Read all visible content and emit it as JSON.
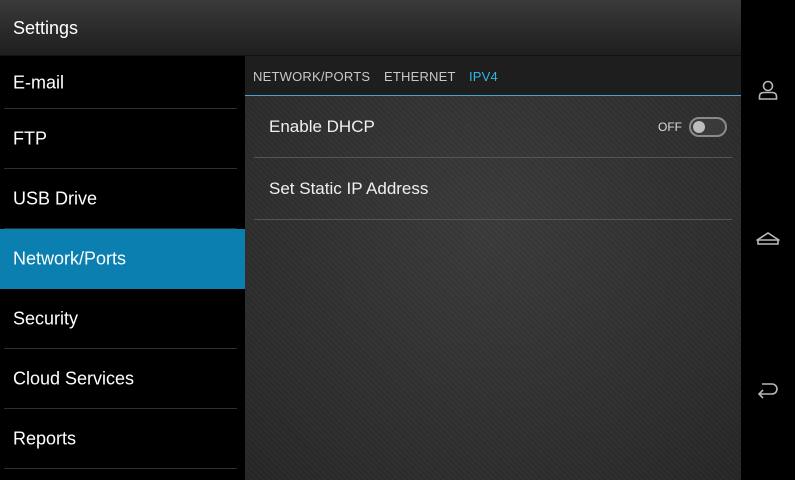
{
  "header": {
    "title": "Settings"
  },
  "sidebar": {
    "items": [
      {
        "label": "E-mail"
      },
      {
        "label": "FTP"
      },
      {
        "label": "USB Drive"
      },
      {
        "label": "Network/Ports",
        "active": true
      },
      {
        "label": "Security"
      },
      {
        "label": "Cloud Services"
      },
      {
        "label": "Reports"
      }
    ]
  },
  "tabs": [
    {
      "label": "NETWORK/PORTS"
    },
    {
      "label": "ETHERNET"
    },
    {
      "label": "IPV4",
      "active": true
    }
  ],
  "settings": {
    "dhcp": {
      "label": "Enable DHCP",
      "state": "OFF"
    },
    "static_ip": {
      "label": "Set Static IP Address"
    }
  },
  "nav": {
    "icons": [
      "user-icon",
      "home-icon",
      "back-icon"
    ]
  },
  "colors": {
    "accent": "#33b5e5",
    "active_item": "#0a7fb0"
  }
}
